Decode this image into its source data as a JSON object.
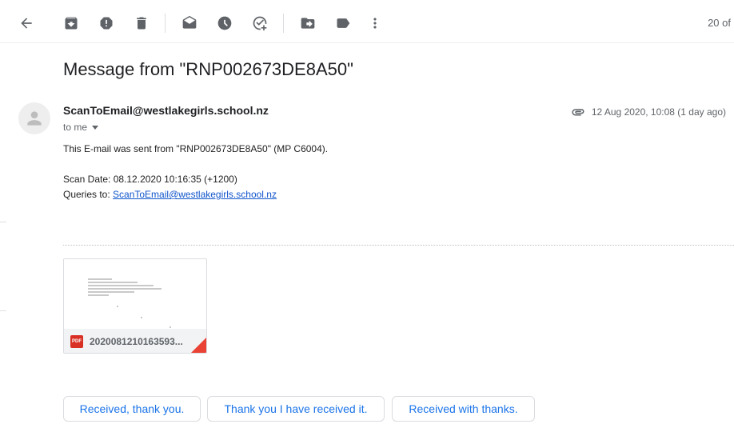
{
  "toolbar": {
    "page_count": "20 of",
    "icons": [
      "back-arrow-icon",
      "archive-icon",
      "report-spam-icon",
      "delete-icon",
      "mark-unread-icon",
      "snooze-icon",
      "add-to-tasks-icon",
      "move-to-icon",
      "label-icon",
      "more-vert-icon"
    ]
  },
  "message": {
    "subject": "Message from \"RNP002673DE8A50\"",
    "sender": "ScanToEmail@westlakegirls.school.nz",
    "to": "to me",
    "date": "12 Aug 2020, 10:08 (1 day ago)",
    "body_line1": "This E-mail was sent from \"RNP002673DE8A50\" (MP C6004).",
    "scan_date": "Scan Date: 08.12.2020 10:16:35 (+1200)",
    "queries_label": "Queries to: ",
    "queries_link": "ScanToEmail@westlakegirls.school.nz"
  },
  "attachment": {
    "badge": "PDF",
    "filename": "2020081210163593..."
  },
  "smart_replies": [
    "Received, thank you.",
    "Thank you I have received it.",
    "Received with thanks."
  ],
  "colors": {
    "link": "#1155cc",
    "chip_text": "#1a73e8",
    "pdf_red": "#d93025"
  }
}
